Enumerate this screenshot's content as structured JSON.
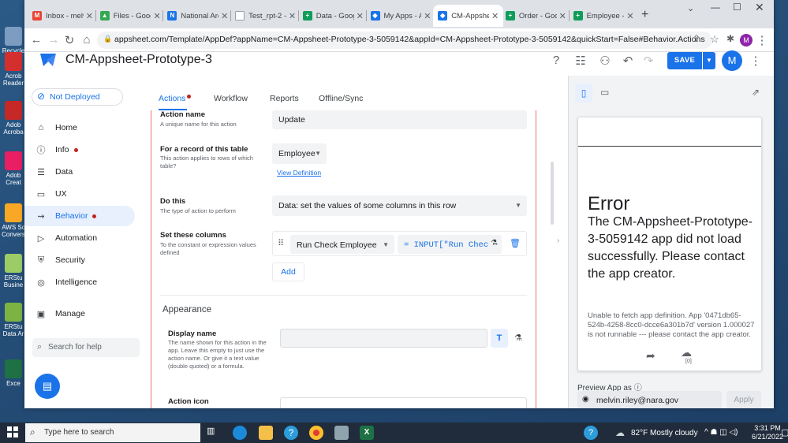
{
  "desktop": {
    "icons": [
      {
        "label": "Recycle",
        "color": "#7c9cc2"
      },
      {
        "label": "Acrob Reader",
        "color": "#d32f2f"
      },
      {
        "label": "Adob Acroba",
        "color": "#c62828"
      },
      {
        "label": "Adob Creat",
        "color": "#e91e63"
      },
      {
        "label": "AWS Sc Convers",
        "color": "#f9a825"
      },
      {
        "label": "ERStu Busine",
        "color": "#9ccc65"
      },
      {
        "label": "ERStu Data Ar",
        "color": "#7cb342"
      },
      {
        "label": "Exce",
        "color": "#1e7145"
      }
    ]
  },
  "browser": {
    "tabs": [
      {
        "title": "Inbox - melv",
        "favicon": "M",
        "color": "#ea4335"
      },
      {
        "title": "Files - Googl",
        "favicon": "▲",
        "color": "#34a853"
      },
      {
        "title": "National Arc",
        "favicon": "N",
        "color": "#1a73e8"
      },
      {
        "title": "Test_rpt-2 -",
        "favicon": "",
        "color": "#ffffff"
      },
      {
        "title": "Data - Goog",
        "favicon": "+",
        "color": "#0f9d58"
      },
      {
        "title": "My Apps - A",
        "favicon": "◆",
        "color": "#1a73e8"
      },
      {
        "title": "CM-Appshe",
        "favicon": "◆",
        "color": "#1a73e8",
        "active": true
      },
      {
        "title": "Order - Goo",
        "favicon": "+",
        "color": "#0f9d58"
      },
      {
        "title": "Employee -",
        "favicon": "+",
        "color": "#0f9d58"
      }
    ],
    "new_tab": "+",
    "url": "appsheet.com/Template/AppDef?appName=CM-Appsheet-Prototype-3-5059142&appId=CM-Appsheet-Prototype-3-5059142&quickStart=False#Behavior.Actions",
    "profile_initial": "M"
  },
  "app": {
    "name": "CM-Appsheet-Prototype-3",
    "save_label": "SAVE",
    "avatar": "M",
    "deploy_status": "Not Deployed",
    "nav": [
      {
        "label": "Home",
        "icon": "⌂"
      },
      {
        "label": "Info",
        "icon": "ⓘ",
        "dot": true
      },
      {
        "label": "Data",
        "icon": "☰"
      },
      {
        "label": "UX",
        "icon": "▭"
      },
      {
        "label": "Behavior",
        "icon": "⇝",
        "dot": true,
        "selected": true
      },
      {
        "label": "Automation",
        "icon": "▷"
      },
      {
        "label": "Security",
        "icon": "⛨"
      },
      {
        "label": "Intelligence",
        "icon": "◎"
      },
      {
        "label": "Manage",
        "icon": "▣"
      }
    ],
    "search_placeholder": "Search for help",
    "subtabs": [
      "Actions",
      "Workflow",
      "Reports",
      "Offline/Sync"
    ],
    "form": {
      "action_name": {
        "label": "Action name",
        "desc": "A unique name for this action",
        "value": "Update"
      },
      "table": {
        "label": "For a record of this table",
        "desc": "This action applies to rows of which table?",
        "value": "Employee",
        "link": "View Definition"
      },
      "do_this": {
        "label": "Do this",
        "desc": "The type of action to perform",
        "value": "Data: set the values of some columns in this row"
      },
      "set_columns": {
        "label": "Set these columns",
        "desc": "To the constant or expression values defined",
        "column": "Run Check Employee",
        "expression": "= INPUT[\"Run Chec",
        "add": "Add"
      },
      "appearance": "Appearance",
      "display_name": {
        "label": "Display name",
        "desc": "The name shown for this action in the app. Leave this empty to just use the action name. Or give it a text value (double quoted) or a formula."
      },
      "action_icon": {
        "label": "Action icon"
      }
    },
    "preview": {
      "error_title": "Error",
      "error_message": "The CM-Appsheet-Prototype-3-5059142 app did not load successfully. Please contact the app creator.",
      "error_detail": "Unable to fetch app definition. App '0471db65-524b-4258-8cc0-dcce6a301b7d' version 1.000027 is not runnable --- please contact the app creator.",
      "sync_count": "[0]",
      "preview_as_label": "Preview App as",
      "preview_user": "melvin.riley@nara.gov",
      "apply_label": "Apply"
    }
  },
  "taskbar": {
    "search_placeholder": "Type here to search",
    "weather": "82°F  Mostly cloudy",
    "time": "3:31 PM",
    "date": "6/21/2022"
  }
}
